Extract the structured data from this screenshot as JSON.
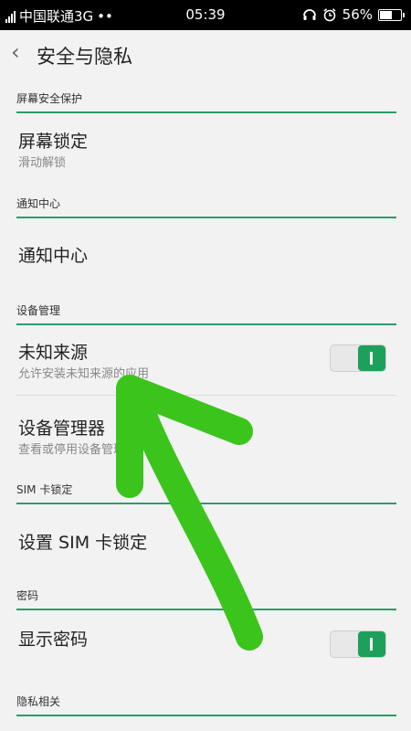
{
  "status_bar": {
    "carrier": "中国联通3G",
    "dots": "••",
    "time": "05:39",
    "battery_pct": "56%",
    "icons": [
      "signal-icon",
      "headset-icon",
      "alarm-icon",
      "battery-icon"
    ]
  },
  "header": {
    "back_icon": "‹",
    "title": "安全与隐私"
  },
  "sections": {
    "screen_security": "屏幕安全保护",
    "notification": "通知中心",
    "device_mgmt": "设备管理",
    "sim_lock": "SIM 卡锁定",
    "password": "密码",
    "privacy": "隐私相关"
  },
  "items": {
    "screen_lock": {
      "title": "屏幕锁定",
      "subtitle": "滑动解锁"
    },
    "notification_center": {
      "title": "通知中心"
    },
    "unknown_sources": {
      "title": "未知来源",
      "subtitle": "允许安装未知来源的应用",
      "enabled": true
    },
    "device_admins": {
      "title": "设备管理器",
      "subtitle": "查看或停用设备管理器"
    },
    "sim_lock": {
      "title": "设置 SIM 卡锁定"
    },
    "show_password": {
      "title": "显示密码",
      "enabled": true
    }
  },
  "colors": {
    "accent": "#2a9d6a",
    "toggle_on": "#1da05a",
    "annotation_arrow": "#3bc41c"
  }
}
